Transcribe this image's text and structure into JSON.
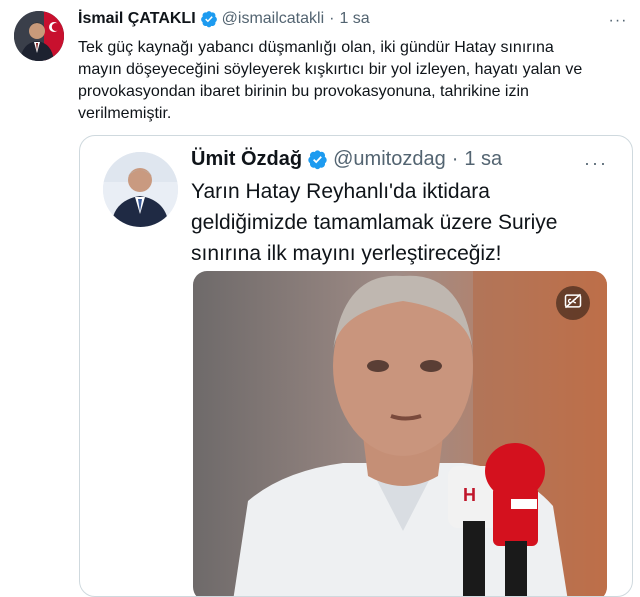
{
  "tweet": {
    "author_name": "İsmail ÇATAKLI",
    "handle": "@ismailcatakli",
    "separator": "·",
    "time": "1 sa",
    "text": "Tek güç kaynağı yabancı düşmanlığı olan, iki gündür Hatay sınırına mayın döşeyeceğini söyleyerek kışkırtıcı bir yol izleyen, hayatı yalan ve provokasyondan ibaret birinin bu provokasyonuna, tahrikine izin verilmemiştir.",
    "more_label": "···"
  },
  "quoted_tweet": {
    "author_name": "Ümit Özdağ",
    "handle": "@umitozdag",
    "separator": "·",
    "time": "1 sa",
    "text": "Yarın Hatay Reyhanlı'da iktidara geldiğimizde tamamlamak üzere Suriye sınırına ilk mayını yerleştireceğiz!",
    "more_label": "···"
  },
  "icons": {
    "verified": "verified-badge-icon",
    "more": "more-icon",
    "captions": "closed-captions-off-icon"
  },
  "colors": {
    "verified": "#1d9bf0",
    "text": "#0f1419",
    "secondary": "#536471",
    "border": "#cfd9de"
  }
}
